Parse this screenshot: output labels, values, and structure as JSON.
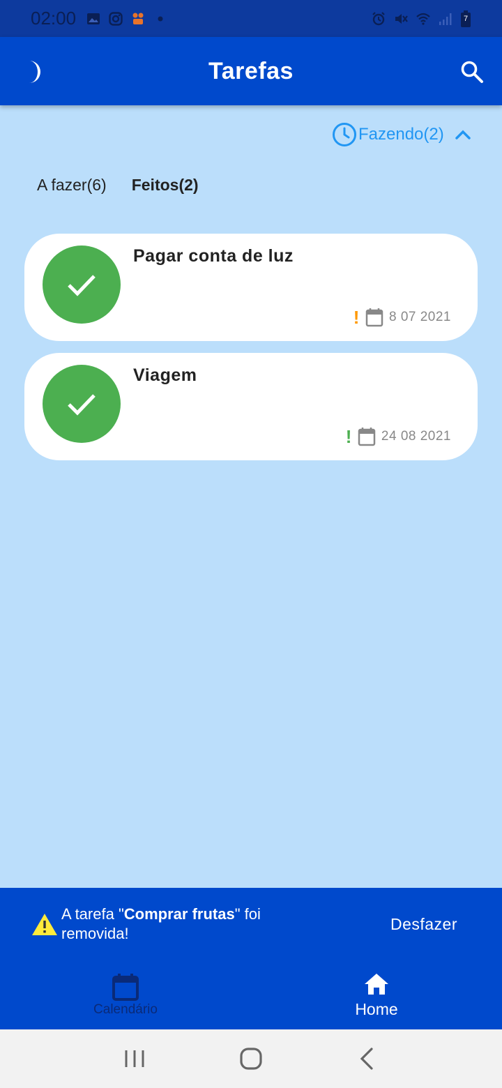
{
  "status_bar": {
    "time": "02:00",
    "battery_level": "7",
    "left_icons": [
      "gallery-icon",
      "instagram-icon",
      "app-notification-icon",
      "dot-icon"
    ],
    "right_icons": [
      "alarm-icon",
      "vibrate-mute-icon",
      "wifi-icon",
      "signal-icon",
      "battery-icon"
    ]
  },
  "app_bar": {
    "title": "Tarefas",
    "left_icon": "moon-icon",
    "right_icon": "search-icon"
  },
  "doing_filter": {
    "label": "Fazendo(2)",
    "icon": "clock-icon",
    "toggle_icon": "chevron-up-icon",
    "color": "#2196F3"
  },
  "tabs": [
    {
      "label": "A fazer(6)",
      "active": false
    },
    {
      "label": "Feitos(2)",
      "active": true
    }
  ],
  "tasks": [
    {
      "title": "Pagar conta de luz",
      "date": "8 07 2021",
      "priority_mark": "!",
      "priority_color": "#FF9800"
    },
    {
      "title": "Viagem",
      "date": "24 08 2021",
      "priority_mark": "!",
      "priority_color": "#4CAF50"
    }
  ],
  "snackbar": {
    "icon": "warning-icon",
    "message_prefix": "A tarefa \"",
    "task_name": "Comprar frutas",
    "message_suffix": "\" foi removida!",
    "action_label": "Desfazer"
  },
  "bottom_nav": [
    {
      "label": "Calendário",
      "icon": "calendar-icon",
      "active": false
    },
    {
      "label": "Home",
      "icon": "home-icon",
      "active": true
    }
  ],
  "system_nav": [
    "recents-icon",
    "home-circle-icon",
    "back-icon"
  ],
  "colors": {
    "background": "#BBDEFB",
    "primary": "#0049CC",
    "status_bar": "#0D3A9E",
    "done_green": "#4CAF50"
  }
}
